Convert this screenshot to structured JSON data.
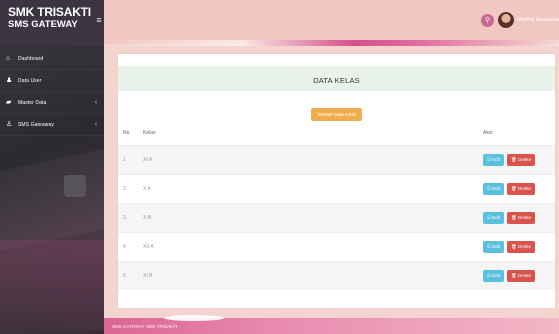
{
  "brand": {
    "line1": "SMK TRISAKTI",
    "line2": "SMS GATEWAY",
    "toggle_icon": "≡"
  },
  "sidebar": {
    "items": [
      {
        "label": "Dashboard",
        "icon": "home-icon",
        "glyph": "⌂",
        "arrow": ""
      },
      {
        "label": "Data User",
        "icon": "users-icon",
        "glyph": "♟",
        "arrow": ""
      },
      {
        "label": "Master Data",
        "icon": "folder-icon",
        "glyph": "▰",
        "arrow": "‹"
      },
      {
        "label": "SMS Gateaway",
        "icon": "user-icon",
        "glyph": "♙",
        "arrow": "‹"
      }
    ]
  },
  "topbar": {
    "search_glyph": "⚲",
    "username": "Martha Gracsella"
  },
  "card": {
    "title": "DATA KELAS",
    "add_button": "Tambah Data Kelas",
    "columns": {
      "no": "No",
      "kelas": "Kelas",
      "aksi": "Aksi"
    },
    "rows": [
      {
        "no": "1",
        "kelas": "XI A"
      },
      {
        "no": "2",
        "kelas": "X A"
      },
      {
        "no": "3",
        "kelas": "X B"
      },
      {
        "no": "4",
        "kelas": "XII A"
      },
      {
        "no": "5",
        "kelas": "XI B"
      }
    ],
    "edit_label": "☑ Edit",
    "delete_label": "🗑 Delete"
  },
  "footer": {
    "text": "SMS GATEWAY SMK TRISAKTI"
  }
}
